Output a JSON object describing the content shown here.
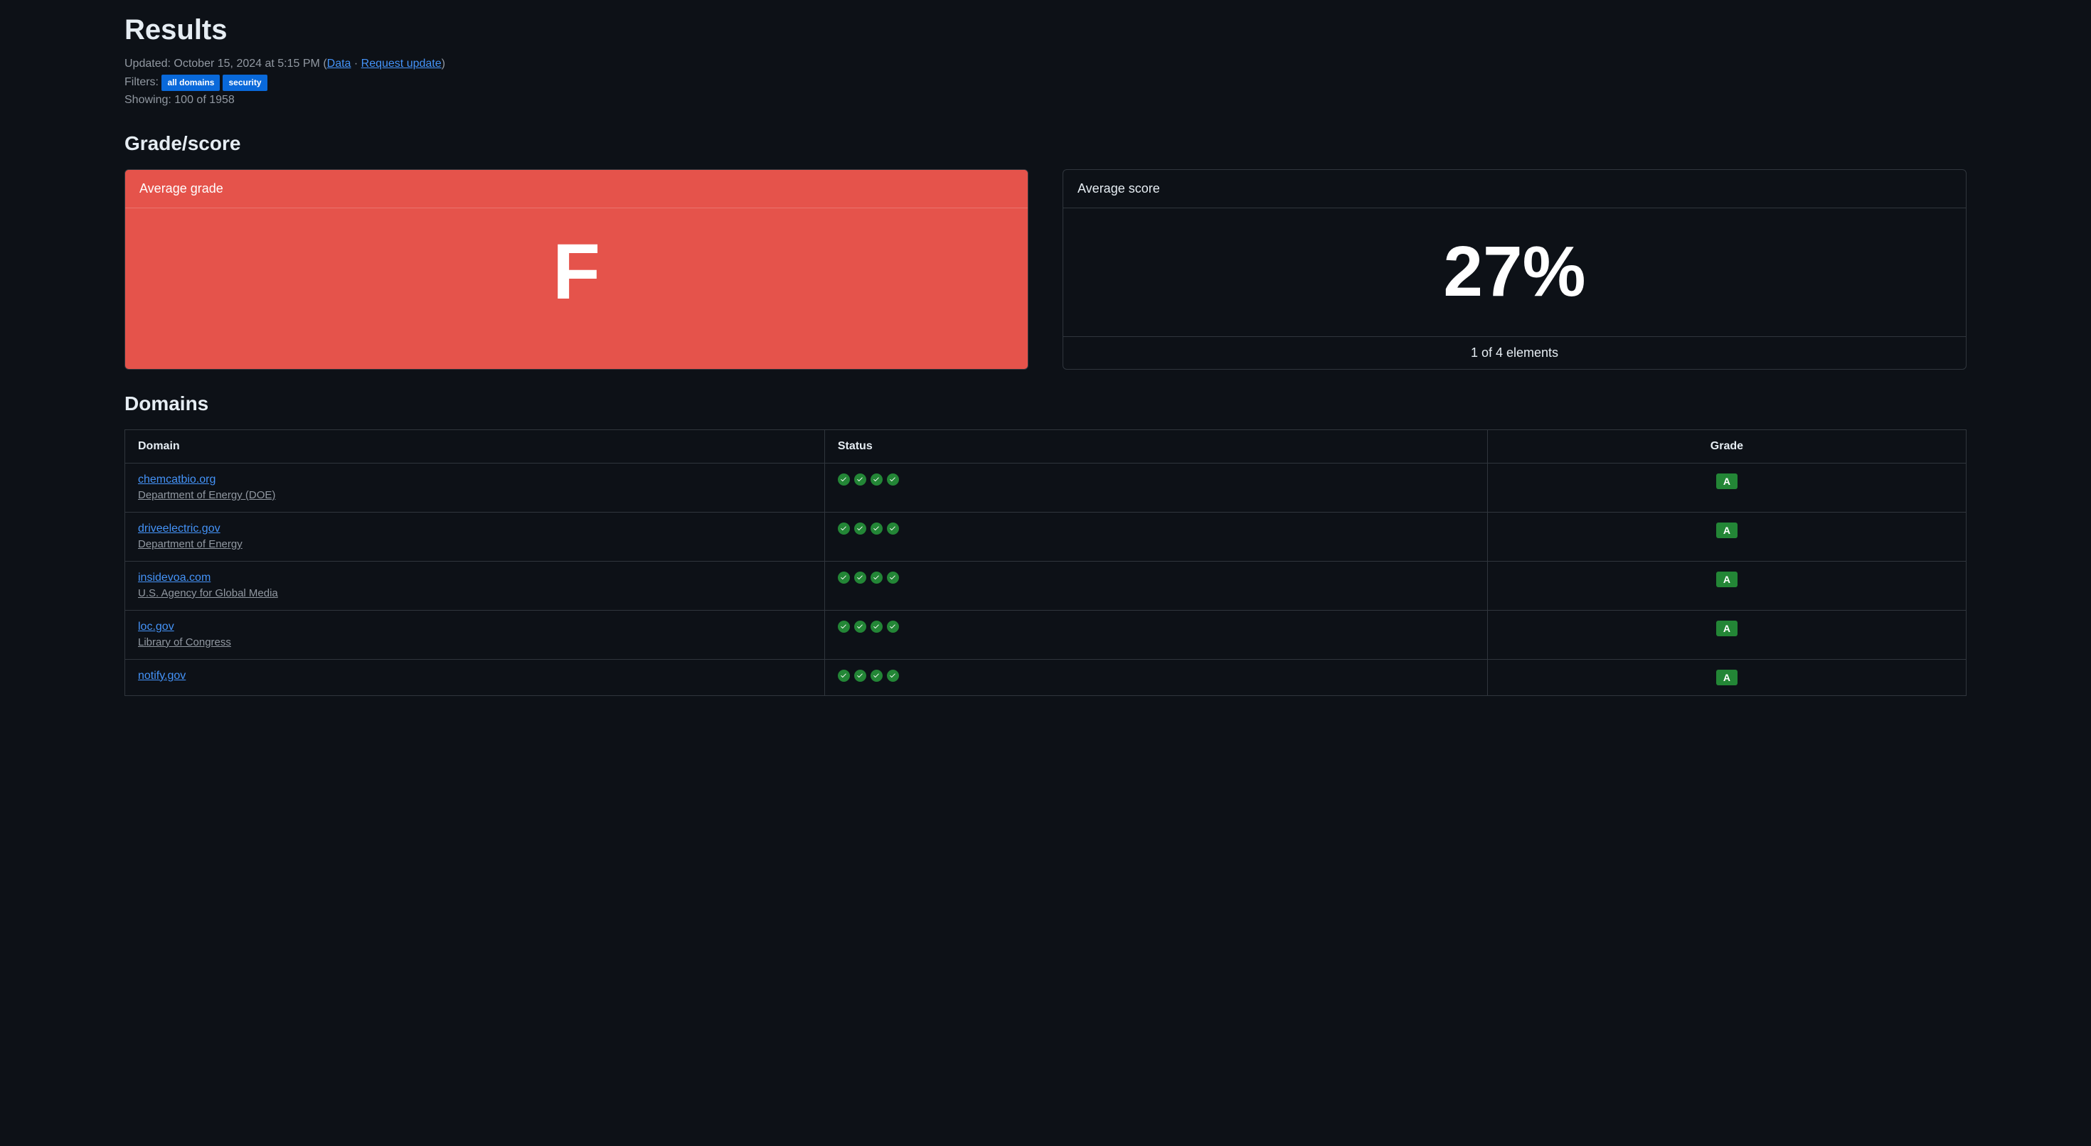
{
  "title": "Results",
  "meta": {
    "updated_label": "Updated:",
    "updated_value": "October 15, 2024 at 5:15 PM",
    "paren_open": "(",
    "data_link": "Data",
    "dot": " · ",
    "request_update_link": "Request update",
    "paren_close": ")",
    "filters_label": "Filters:",
    "filter_tags": [
      "all domains",
      "security"
    ],
    "showing_label": "Showing:",
    "showing_value": "100 of 1958"
  },
  "grade_section": {
    "heading": "Grade/score",
    "avg_grade_label": "Average grade",
    "avg_grade_value": "F",
    "avg_score_label": "Average score",
    "avg_score_value": "27%",
    "score_footer": "1 of 4 elements"
  },
  "domains_section": {
    "heading": "Domains",
    "columns": [
      "Domain",
      "Status",
      "Grade"
    ],
    "rows": [
      {
        "domain": "chemcatbio.org",
        "agency": "Department of Energy (DOE)",
        "checks": 4,
        "grade": "A"
      },
      {
        "domain": "driveelectric.gov",
        "agency": "Department of Energy",
        "checks": 4,
        "grade": "A"
      },
      {
        "domain": "insidevoa.com",
        "agency": "U.S. Agency for Global Media",
        "checks": 4,
        "grade": "A"
      },
      {
        "domain": "loc.gov",
        "agency": "Library of Congress",
        "checks": 4,
        "grade": "A"
      },
      {
        "domain": "notify.gov",
        "agency": "",
        "checks": 4,
        "grade": "A"
      }
    ]
  }
}
